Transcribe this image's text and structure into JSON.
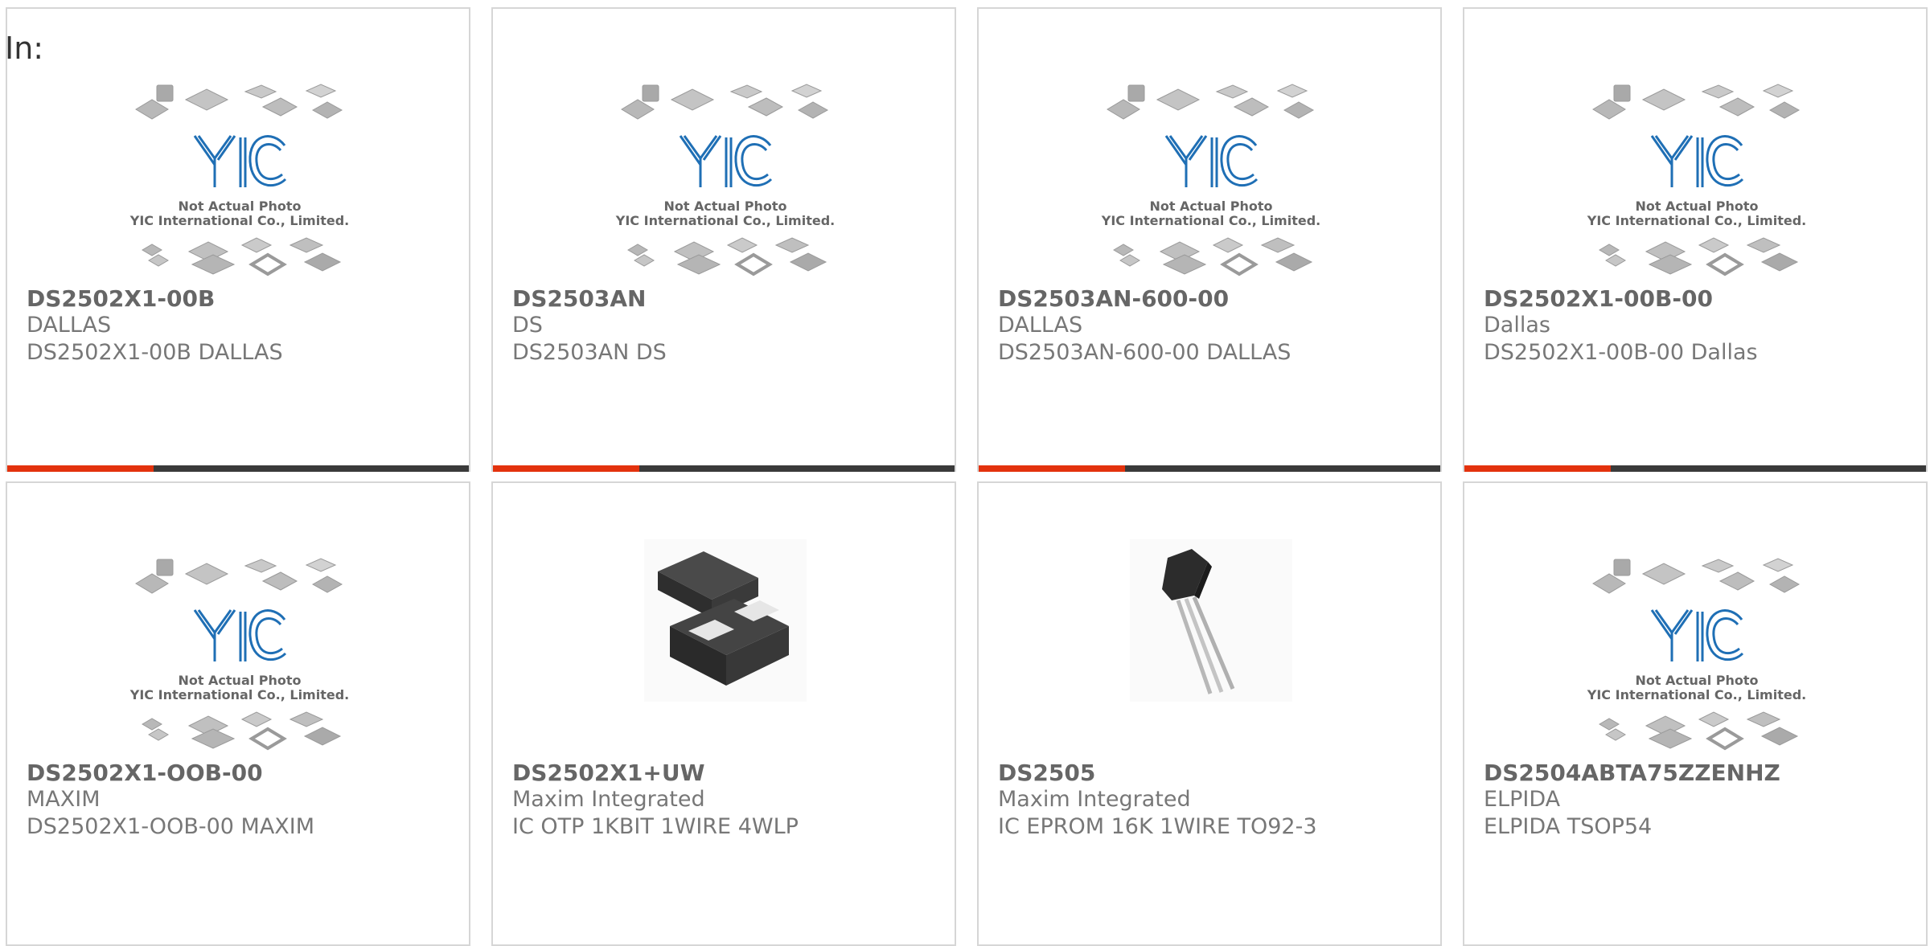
{
  "header": {
    "in_label": "In:"
  },
  "placeholder": {
    "line1": "Not Actual Photo",
    "line2": "YIC International Co., Limited.",
    "logo": "YIC"
  },
  "products": [
    {
      "part": "DS2502X1-00B",
      "mfr": "DALLAS",
      "desc": "DS2502X1-00B DALLAS",
      "image": "placeholder",
      "accent_bar": true
    },
    {
      "part": "DS2503AN",
      "mfr": "DS",
      "desc": "DS2503AN DS",
      "image": "placeholder",
      "accent_bar": true
    },
    {
      "part": "DS2503AN-600-00",
      "mfr": "DALLAS",
      "desc": "DS2503AN-600-00 DALLAS",
      "image": "placeholder",
      "accent_bar": true
    },
    {
      "part": "DS2502X1-00B-00",
      "mfr": "Dallas",
      "desc": "DS2502X1-00B-00 Dallas",
      "image": "placeholder",
      "accent_bar": true
    },
    {
      "part": "DS2502X1-OOB-00",
      "mfr": "MAXIM",
      "desc": "DS2502X1-OOB-00 MAXIM",
      "image": "placeholder",
      "accent_bar": false
    },
    {
      "part": "DS2502X1+UW",
      "mfr": "Maxim Integrated",
      "desc": "IC OTP 1KBIT 1WIRE 4WLP",
      "image": "chip-package-photo",
      "accent_bar": false
    },
    {
      "part": "DS2505",
      "mfr": "Maxim Integrated",
      "desc": "IC EPROM 16K 1WIRE TO92-3",
      "image": "to92-transistor-photo",
      "accent_bar": false
    },
    {
      "part": "DS2504ABTA75ZZENHZ",
      "mfr": "ELPIDA",
      "desc": "ELPIDA TSOP54",
      "image": "placeholder",
      "accent_bar": false
    }
  ],
  "colors": {
    "accent": "#e3320d",
    "bar": "#3a3a3a",
    "logo_blue": "#1f6fb5"
  }
}
